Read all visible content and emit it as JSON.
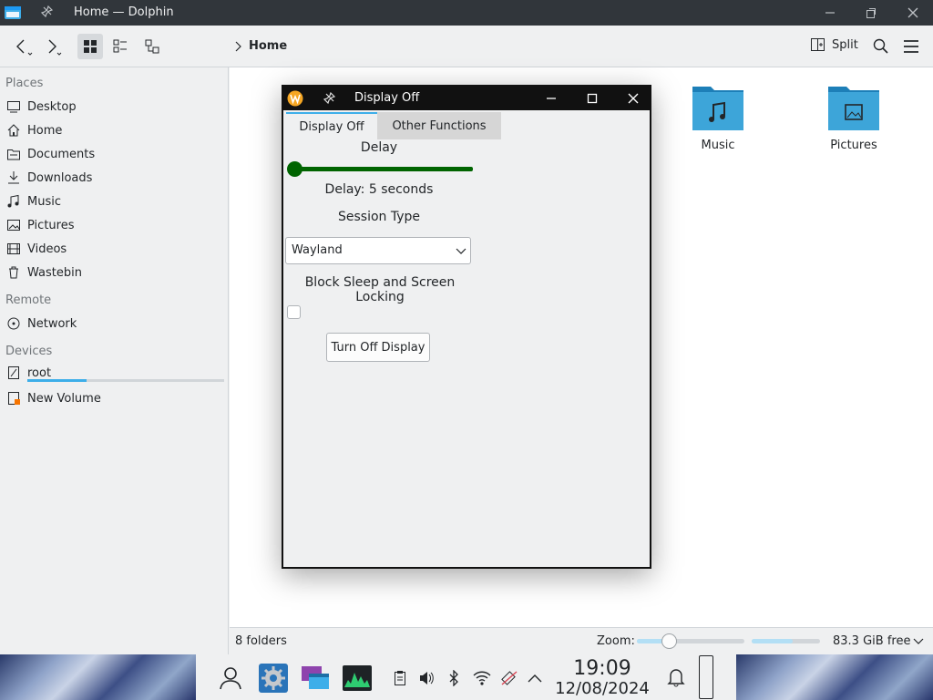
{
  "window": {
    "title": "Home — Dolphin"
  },
  "toolbar": {
    "breadcrumb": "Home",
    "split_label": "Split"
  },
  "sidebar": {
    "places_header": "Places",
    "places": [
      {
        "label": "Desktop",
        "icon": "desktop-icon"
      },
      {
        "label": "Home",
        "icon": "home-icon"
      },
      {
        "label": "Documents",
        "icon": "documents-icon"
      },
      {
        "label": "Downloads",
        "icon": "downloads-icon"
      },
      {
        "label": "Music",
        "icon": "music-icon"
      },
      {
        "label": "Pictures",
        "icon": "pictures-icon"
      },
      {
        "label": "Videos",
        "icon": "videos-icon"
      },
      {
        "label": "Wastebin",
        "icon": "wastebin-icon"
      }
    ],
    "remote_header": "Remote",
    "remote": [
      {
        "label": "Network",
        "icon": "network-icon"
      }
    ],
    "devices_header": "Devices",
    "devices": [
      {
        "label": "root",
        "icon": "drive-icon",
        "usage": 0.3
      },
      {
        "label": "New Volume",
        "icon": "volume-icon"
      }
    ]
  },
  "main": {
    "folders": [
      {
        "label": "Music",
        "icon": "music-folder-icon"
      },
      {
        "label": "Pictures",
        "icon": "pictures-folder-icon"
      }
    ]
  },
  "statusbar": {
    "count": "8 folders",
    "zoom_label": "Zoom:",
    "free_space": "83.3 GiB free",
    "zoom_level": 0.3,
    "space_used": 0.6
  },
  "dialog": {
    "title": "Display Off",
    "tabs": [
      "Display Off",
      "Other Functions"
    ],
    "delay_label": "Delay",
    "delay_text": "Delay: 5 seconds",
    "session_label": "Session Type",
    "session_value": "Wayland",
    "block_label": "Block Sleep and Screen Locking",
    "block_checked": false,
    "button": "Turn Off Display",
    "slider_value": 0
  },
  "taskbar": {
    "time": "19:09",
    "date": "12/08/2024"
  },
  "colors": {
    "titlebar": "#31363b",
    "accent": "#3daee9",
    "slider": "#006400",
    "folder": "#3da5d9"
  }
}
